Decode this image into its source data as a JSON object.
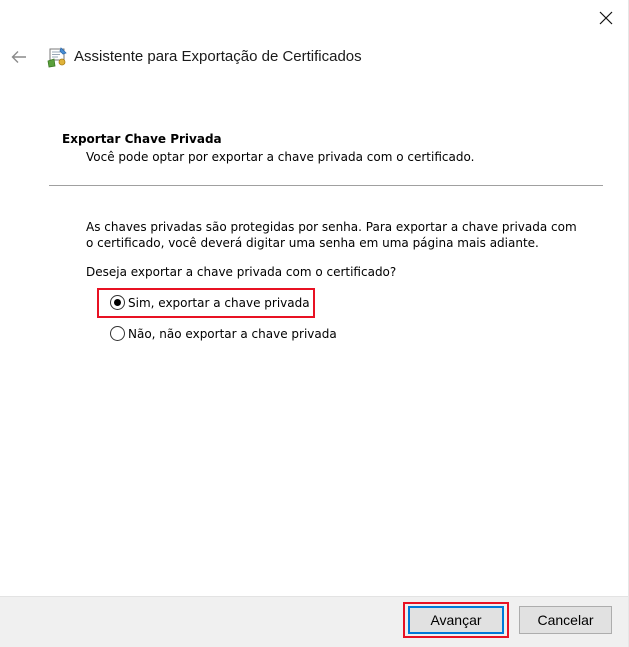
{
  "window": {
    "title": "Assistente para Exportação de Certificados"
  },
  "icons": {
    "close": "close-icon",
    "back": "arrow-left-icon",
    "wizard": "certificate-wizard-icon"
  },
  "header": {
    "title": "Exportar Chave Privada",
    "description": "Você pode optar por exportar a chave privada com o certificado."
  },
  "body": {
    "paragraph": "As chaves privadas são protegidas por senha. Para exportar a chave privada com o certificado, você deverá digitar uma senha em uma página mais adiante.",
    "question": "Deseja exportar a chave privada com o certificado?",
    "options": [
      {
        "label": "Sim, exportar a chave privada",
        "selected": true
      },
      {
        "label": "Não, não exportar a chave privada",
        "selected": false
      }
    ]
  },
  "buttons": {
    "next": "Avançar",
    "cancel": "Cancelar"
  },
  "colors": {
    "highlight": "#e81123",
    "focus": "#0078d7",
    "footer_bg": "#f0f0f0"
  }
}
